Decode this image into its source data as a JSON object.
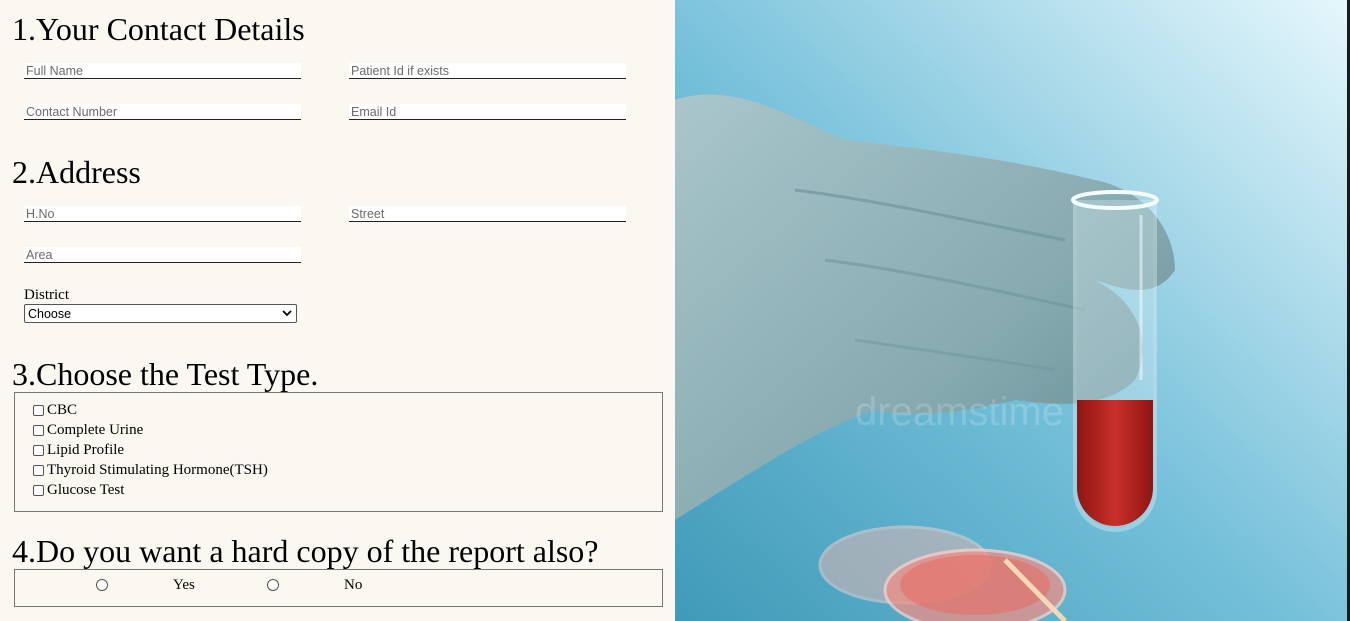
{
  "contact": {
    "title": "1.Your Contact Details",
    "full_name_placeholder": "Full Name",
    "patient_id_placeholder": "Patient Id if exists",
    "contact_number_placeholder": "Contact Number",
    "email_placeholder": "Email Id"
  },
  "address": {
    "title": "2.Address",
    "hno_placeholder": "H.No",
    "street_placeholder": "Street",
    "area_placeholder": "Area",
    "district_label": "District",
    "district_selected": "Choose"
  },
  "tests": {
    "title": "3.Choose the Test Type.",
    "options": [
      {
        "label": "CBC",
        "checked": false
      },
      {
        "label": "Complete Urine",
        "checked": false
      },
      {
        "label": "Lipid Profile",
        "checked": false
      },
      {
        "label": "Thyroid Stimulating Hormone(TSH)",
        "checked": false
      },
      {
        "label": "Glucose Test",
        "checked": false
      }
    ]
  },
  "hardcopy": {
    "title": "4.Do you want a hard copy of the report also?",
    "yes_label": "Yes",
    "no_label": "No"
  },
  "photo": {
    "watermark": "dreamstime",
    "colors": {
      "background": "#7cc4dc",
      "glove": "#8fb3b8",
      "blood": "#b8221c"
    }
  }
}
